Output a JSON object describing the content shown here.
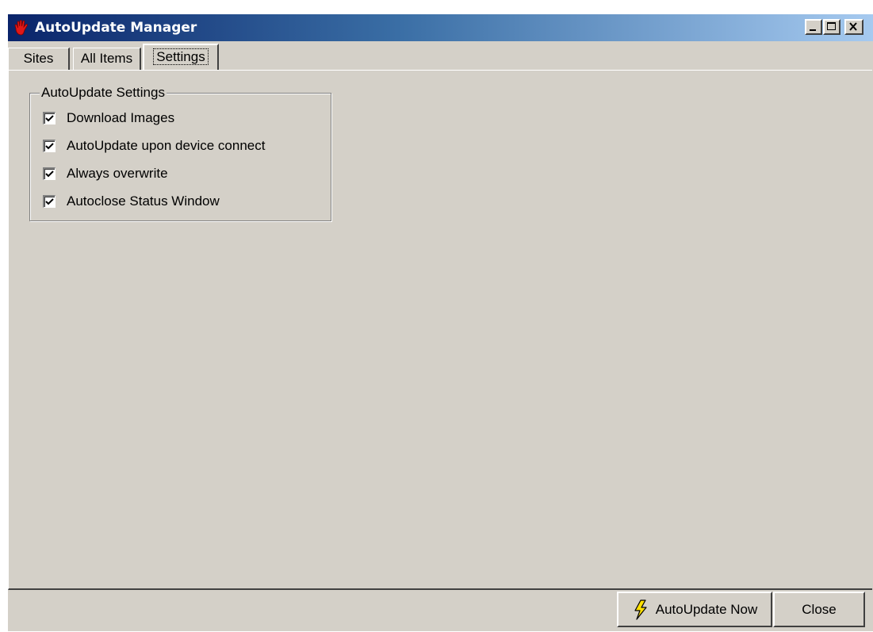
{
  "window": {
    "title": "AutoUpdate Manager",
    "app_icon": "red-hand-icon",
    "controls": [
      "minimize-icon",
      "maximize-icon",
      "close-icon"
    ]
  },
  "tabs": [
    {
      "label": "Sites",
      "selected": false
    },
    {
      "label": "All Items",
      "selected": false
    },
    {
      "label": "Settings",
      "selected": true
    }
  ],
  "settings": {
    "group_label": "AutoUpdate Settings",
    "options": [
      {
        "label": "Download Images",
        "checked": true
      },
      {
        "label": "AutoUpdate upon device connect",
        "checked": true
      },
      {
        "label": "Always overwrite",
        "checked": true
      },
      {
        "label": "Autoclose Status Window",
        "checked": true
      }
    ]
  },
  "buttons": {
    "autoupdate_now": "AutoUpdate Now",
    "autoupdate_icon": "lightning-bolt-icon",
    "close": "Close"
  },
  "colors": {
    "title_gradient_start": "#0a246a",
    "title_gradient_end": "#a6caf0",
    "face": "#d4d0c8",
    "bolt": "#ffe000"
  }
}
